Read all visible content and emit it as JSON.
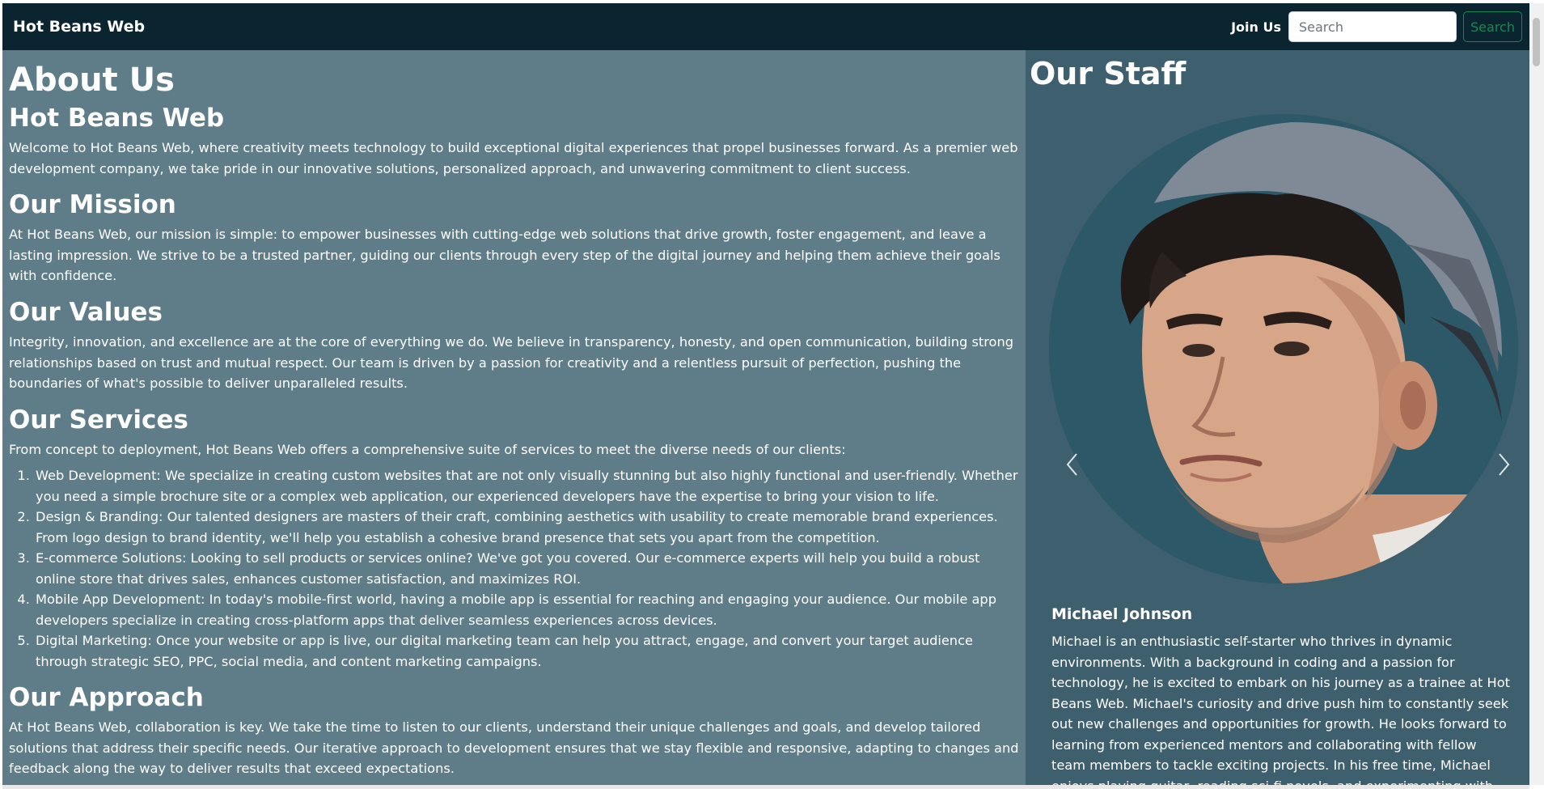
{
  "nav": {
    "brand": "Hot Beans Web",
    "join_label": "Join Us",
    "search_placeholder": "Search",
    "search_button": "Search"
  },
  "about": {
    "title": "About Us",
    "company_heading": "Hot Beans Web",
    "intro": "Welcome to Hot Beans Web, where creativity meets technology to build exceptional digital experiences that propel businesses forward. As a premier web development company, we take pride in our innovative solutions, personalized approach, and unwavering commitment to client success.",
    "mission_heading": "Our Mission",
    "mission": "At Hot Beans Web, our mission is simple: to empower businesses with cutting-edge web solutions that drive growth, foster engagement, and leave a lasting impression. We strive to be a trusted partner, guiding our clients through every step of the digital journey and helping them achieve their goals with confidence.",
    "values_heading": "Our Values",
    "values": "Integrity, innovation, and excellence are at the core of everything we do. We believe in transparency, honesty, and open communication, building strong relationships based on trust and mutual respect. Our team is driven by a passion for creativity and a relentless pursuit of perfection, pushing the boundaries of what's possible to deliver unparalleled results.",
    "services_heading": "Our Services",
    "services_intro": "From concept to deployment, Hot Beans Web offers a comprehensive suite of services to meet the diverse needs of our clients:",
    "services": [
      "Web Development: We specialize in creating custom websites that are not only visually stunning but also highly functional and user-friendly. Whether you need a simple brochure site or a complex web application, our experienced developers have the expertise to bring your vision to life.",
      "Design & Branding: Our talented designers are masters of their craft, combining aesthetics with usability to create memorable brand experiences. From logo design to brand identity, we'll help you establish a cohesive brand presence that sets you apart from the competition.",
      "E-commerce Solutions: Looking to sell products or services online? We've got you covered. Our e-commerce experts will help you build a robust online store that drives sales, enhances customer satisfaction, and maximizes ROI.",
      "Mobile App Development: In today's mobile-first world, having a mobile app is essential for reaching and engaging your audience. Our mobile app developers specialize in creating cross-platform apps that deliver seamless experiences across devices.",
      "Digital Marketing: Once your website or app is live, our digital marketing team can help you attract, engage, and convert your target audience through strategic SEO, PPC, social media, and content marketing campaigns."
    ],
    "approach_heading": "Our Approach",
    "approach": "At Hot Beans Web, collaboration is key. We take the time to listen to our clients, understand their unique challenges and goals, and develop tailored solutions that address their specific needs. Our iterative approach to development ensures that we stay flexible and responsive, adapting to changes and feedback along the way to deliver results that exceed expectations."
  },
  "staff": {
    "title": "Our Staff",
    "member_name": "Michael Johnson",
    "member_bio": "Michael is an enthusiastic self-starter who thrives in dynamic environments. With a background in coding and a passion for technology, he is excited to embark on his journey as a trainee at Hot Beans Web. Michael's curiosity and drive push him to constantly seek out new challenges and opportunities for growth. He looks forward to learning from experienced mentors and collaborating with fellow team members to tackle exciting projects. In his free time, Michael enjoys playing guitar, reading sci-fi novels, and experimenting with new recipes in the kitchen."
  },
  "icons": {
    "prev": "chevron-left-icon",
    "next": "chevron-right-icon"
  },
  "colors": {
    "navbar": "#0a2530",
    "about_bg": "#5f7d88",
    "staff_bg": "#3e5f6d",
    "search_button": "#198754"
  }
}
